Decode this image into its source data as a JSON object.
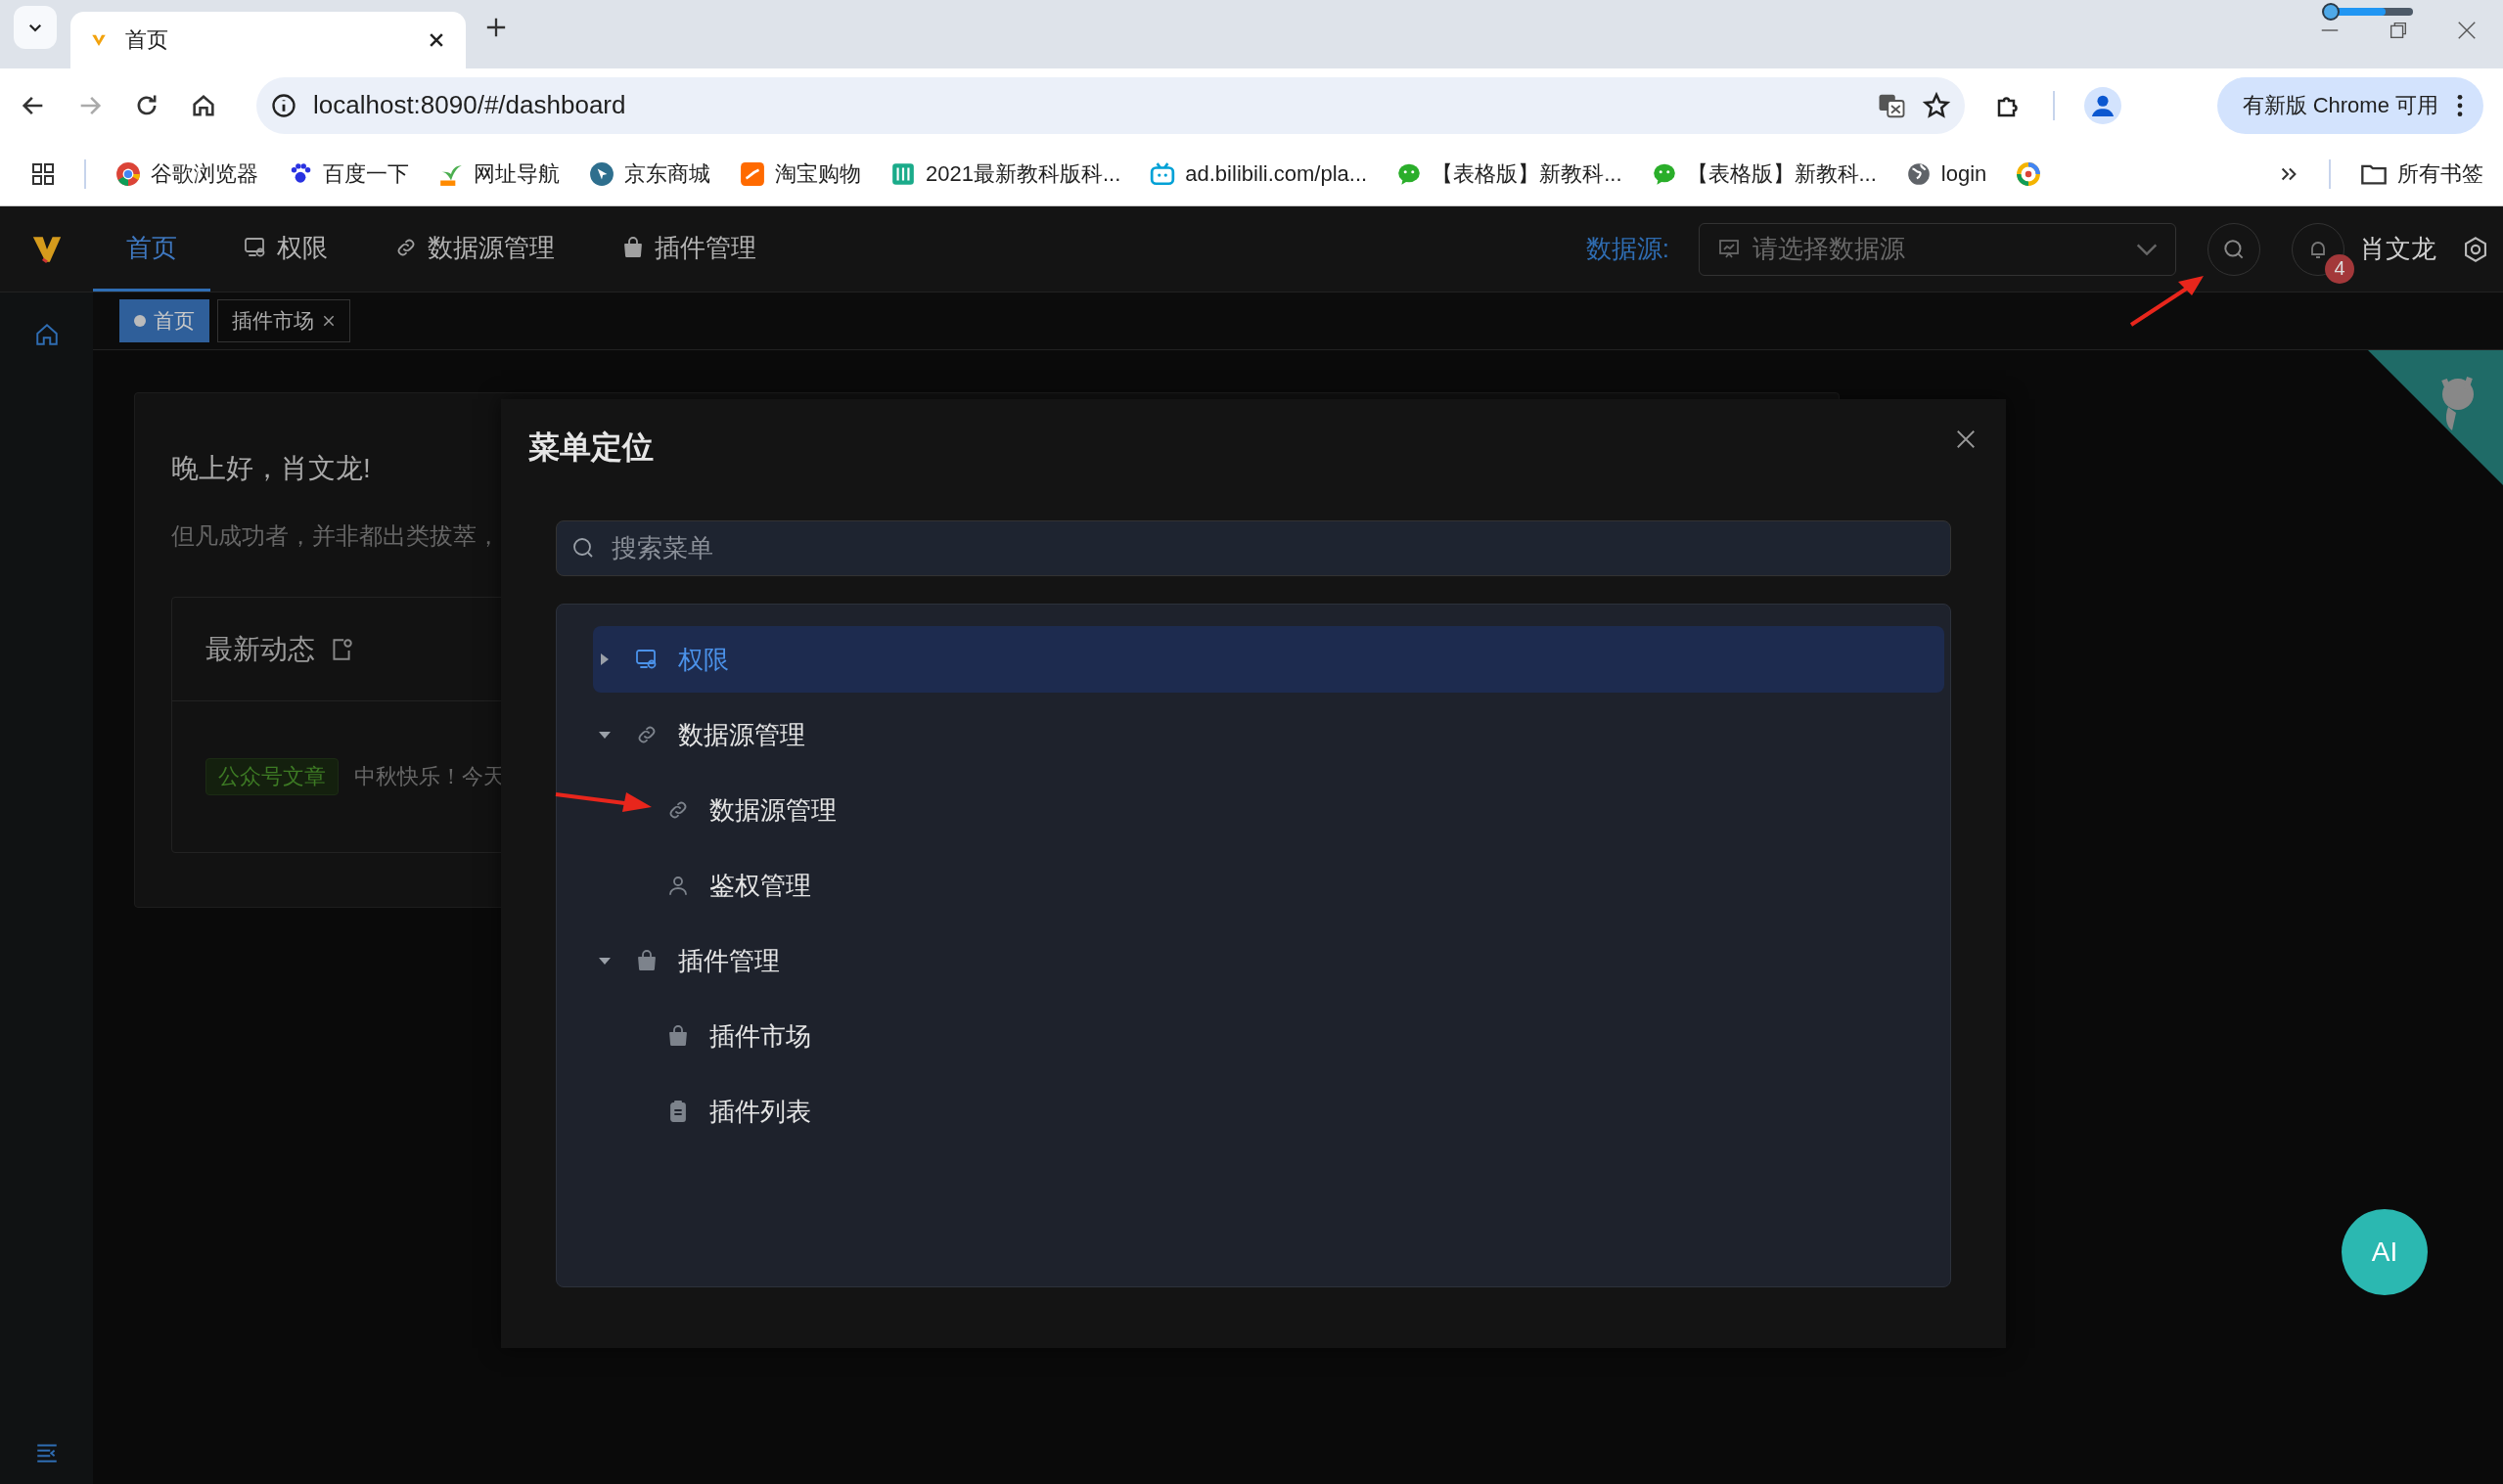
{
  "browser": {
    "tabs": [
      {
        "title": "首页",
        "selected": true
      }
    ],
    "address": "localhost:8090/#/dashboard",
    "update_button": "有新版 Chrome 可用",
    "bookmarks": [
      {
        "label": "谷歌浏览器",
        "kind": "chrome"
      },
      {
        "label": "百度一下",
        "kind": "paw"
      },
      {
        "label": "网址导航",
        "kind": "leaf"
      },
      {
        "label": "京东商城",
        "kind": "pointer"
      },
      {
        "label": "淘宝购物",
        "kind": "shop"
      },
      {
        "label": "2021最新教科版科...",
        "kind": "book"
      },
      {
        "label": "ad.bilibili.com/pla...",
        "kind": "tv"
      },
      {
        "label": "【表格版】新教科...",
        "kind": "chat"
      },
      {
        "label": "【表格版】新教科...",
        "kind": "chat"
      },
      {
        "label": "login",
        "kind": "globe"
      },
      {
        "kind": "ring"
      }
    ],
    "all_bookmarks": "所有书签"
  },
  "app": {
    "nav": [
      {
        "label": "首页",
        "selected": true
      },
      {
        "label": "权限",
        "kind": "monitor",
        "selected": false
      },
      {
        "label": "数据源管理",
        "kind": "link",
        "selected": false
      },
      {
        "label": "插件管理",
        "kind": "bag",
        "selected": false
      }
    ],
    "datasource_label": "数据源:",
    "datasource_placeholder": "请选择数据源",
    "notification_count": "4",
    "user_name": "肖文龙"
  },
  "page_tabs": [
    {
      "label": "首页",
      "selected": true,
      "closable": false
    },
    {
      "label": "插件市场",
      "selected": false,
      "closable": true
    }
  ],
  "dashboard": {
    "greeting": "晚上好，肖文龙!",
    "motto": "但凡成功者，并非都出类拔萃，",
    "news_title": "最新动态",
    "news": [
      {
        "tag": "公众号文章",
        "text": "中秋快乐！今天"
      }
    ]
  },
  "dialog": {
    "title": "菜单定位",
    "search_placeholder": "搜索菜单",
    "tree": [
      {
        "label": "权限",
        "kind": "monitor",
        "selected": true,
        "expanded": false
      },
      {
        "label": "数据源管理",
        "kind": "link",
        "selected": false,
        "expanded": true,
        "children": [
          {
            "label": "数据源管理",
            "kind": "link",
            "selected": false
          },
          {
            "label": "鉴权管理",
            "kind": "user",
            "selected": false
          }
        ]
      },
      {
        "label": "插件管理",
        "kind": "bag",
        "selected": false,
        "expanded": true,
        "children": [
          {
            "label": "插件市场",
            "kind": "bag",
            "selected": false
          },
          {
            "label": "插件列表",
            "kind": "clipboard",
            "selected": false
          }
        ]
      }
    ]
  },
  "ai_button": "AI"
}
